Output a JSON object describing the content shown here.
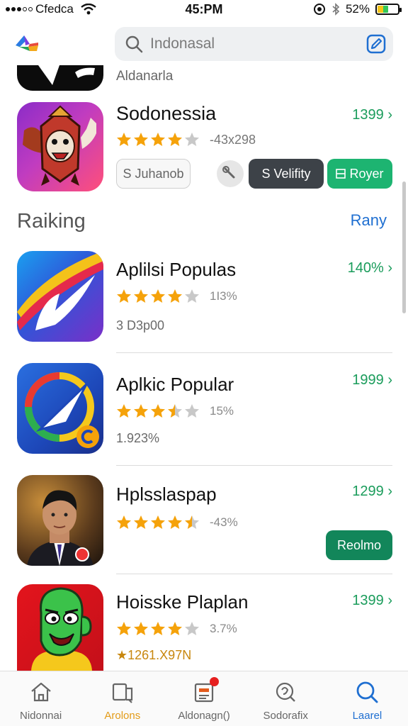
{
  "status_bar": {
    "carrier": "Cfedca",
    "time": "45:PM",
    "battery": "52%",
    "battery_level": 0.52
  },
  "header": {
    "search": {
      "placeholder": "Indonasal"
    }
  },
  "featured": {
    "partial_label": "Aldanarla",
    "title": "Sodonessia",
    "price": "1399 ›",
    "rating": 4,
    "rating_text": "-43x298",
    "chips": {
      "outline": "S Juhanob",
      "dark": "S Velifity",
      "green": "Royer"
    }
  },
  "ranking": {
    "title": "Raiking",
    "link": "Rany",
    "items": [
      {
        "title": "Aplilsi Populas",
        "rating": 4,
        "rating_text": "1I3%",
        "subtitle": "3 D3p00",
        "price": "140% ›"
      },
      {
        "title": "Aplkic Popular",
        "rating": 3.5,
        "rating_text": "15%",
        "subtitle": "1.923%",
        "price": "1999 ›"
      },
      {
        "title": "Hplsslaspap",
        "rating": 4.5,
        "rating_text": "-43%",
        "subtitle": "",
        "price": "1299 ›",
        "button": "Reolmo"
      },
      {
        "title": "Hoisske Plaplan",
        "rating": 4,
        "rating_text": "3.7%",
        "subtitle": "★1261.X97N",
        "price": "1399 ›"
      }
    ]
  },
  "tabs": [
    {
      "label": "Nidonnai",
      "icon": "home-icon"
    },
    {
      "label": "Arolons",
      "icon": "apps-icon"
    },
    {
      "label": "Aldonagn()",
      "icon": "updates-icon"
    },
    {
      "label": "Sodorafix",
      "icon": "discover-icon"
    },
    {
      "label": "Laarel",
      "icon": "search-icon"
    }
  ],
  "colors": {
    "accent_green": "#1a9c5b",
    "accent_blue": "#1f6fd1",
    "star": "#f5a20a",
    "star_empty": "#c8c8c8"
  }
}
